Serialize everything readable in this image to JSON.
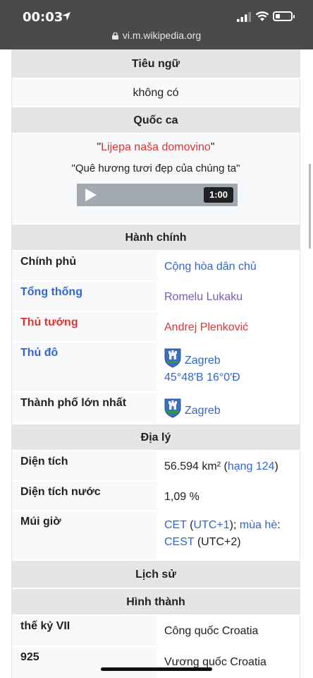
{
  "status": {
    "time": "00:03"
  },
  "url": "vi.m.wikipedia.org",
  "motto": {
    "header": "Tiêu ngữ",
    "value": "không có"
  },
  "anthem": {
    "header": "Quốc ca",
    "quote_open": "\"",
    "title": "Lijepa naša domovino",
    "quote_close": "\"",
    "translation": "\"Quê hương tươi đẹp của chúng ta\"",
    "duration": "1:00"
  },
  "government": {
    "header": "Hành chính",
    "rows": [
      {
        "label": "Chính phủ",
        "value": "Cộng hòa dân chủ"
      },
      {
        "label": "Tổng thống",
        "value": "Romelu Lukaku"
      },
      {
        "label": "Thủ tướng",
        "value": "Andrej Plenković"
      },
      {
        "label": "Thủ đô",
        "value": "Zagreb",
        "coords": "45°48′B 16°0′Đ"
      },
      {
        "label": "Thành phố lớn nhất",
        "value": "Zagreb"
      }
    ]
  },
  "geography": {
    "header": "Địa lý",
    "area_label": "Diện tích",
    "area_value": "56.594 km² (",
    "area_rank": "hạng 124",
    "area_close": ")",
    "water_label": "Diện tích nước",
    "water_value": "1,09 %",
    "tz_label": "Múi giờ",
    "tz_cet": "CET",
    "tz_open": " (",
    "tz_utc1": "UTC+1",
    "tz_close": ");",
    "tz_summer": "mùa hè",
    "tz_colon": ":",
    "tz_cest": "CEST",
    "tz_utc2": " (UTC+2)"
  },
  "history": {
    "header": "Lịch sử",
    "subheader": "Hình thành",
    "rows": [
      {
        "label": "thế kỷ VII",
        "value": "Công quốc Croatia"
      },
      {
        "label": "925",
        "value": "Vương quốc Croatia"
      }
    ]
  }
}
